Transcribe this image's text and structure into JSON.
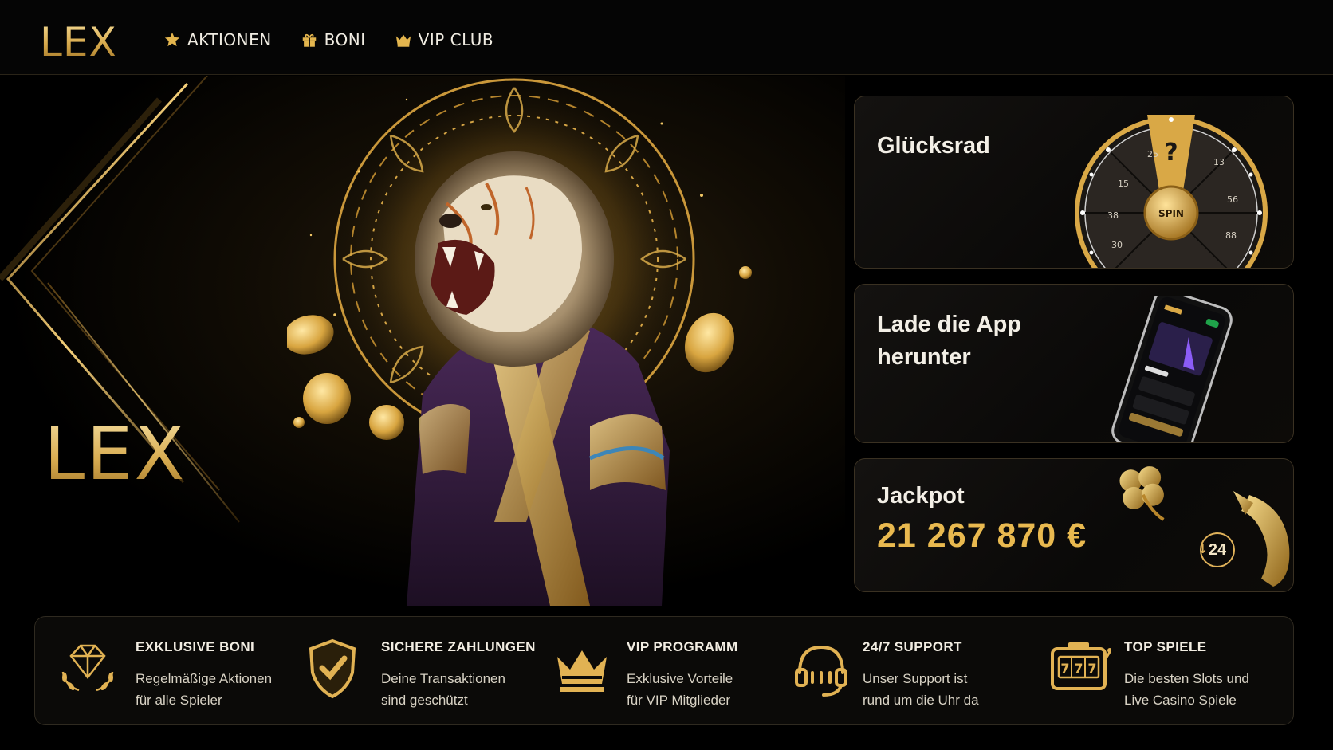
{
  "header": {
    "logo": "LEX",
    "nav": [
      {
        "label": "AKTIONEN",
        "icon": "star-icon"
      },
      {
        "label": "BONI",
        "icon": "gift-icon"
      },
      {
        "label": "VIP CLUB",
        "icon": "crown-icon"
      }
    ]
  },
  "hero": {
    "logo": "LEX"
  },
  "cards": {
    "wheel": {
      "title": "Glücksrad",
      "spin_label": "SPIN",
      "wheel_numbers": [
        "25",
        "?",
        "15",
        "13",
        "38",
        "56",
        "30",
        "88"
      ]
    },
    "app": {
      "title_line1": "Lade die App",
      "title_line2": "herunter"
    },
    "jackpot": {
      "title": "Jackpot",
      "amount": "21 267 870 €",
      "badge": "24"
    }
  },
  "features": [
    {
      "title": "EXKLUSIVE BONI",
      "line1": "Regelmäßige Aktionen",
      "line2": "für alle Spieler",
      "icon": "diamond-icon"
    },
    {
      "title": "SICHERE ZAHLUNGEN",
      "line1": "Deine Transaktionen",
      "line2": "sind geschützt",
      "icon": "shield-icon"
    },
    {
      "title": "VIP PROGRAMM",
      "line1": "Exklusive Vorteile",
      "line2": "für VIP Mitglieder",
      "icon": "crown-icon"
    },
    {
      "title": "24/7 SUPPORT",
      "line1": "Unser Support ist",
      "line2": "rund um die Uhr da",
      "icon": "headset-icon"
    },
    {
      "title": "TOP SPIELE",
      "line1": "Die besten Slots und",
      "line2": "Live Casino Spiele",
      "icon": "slot-machine-icon"
    }
  ],
  "colors": {
    "gold": "#e9b94f",
    "gold_light": "#f7df9c",
    "background": "#000000"
  }
}
